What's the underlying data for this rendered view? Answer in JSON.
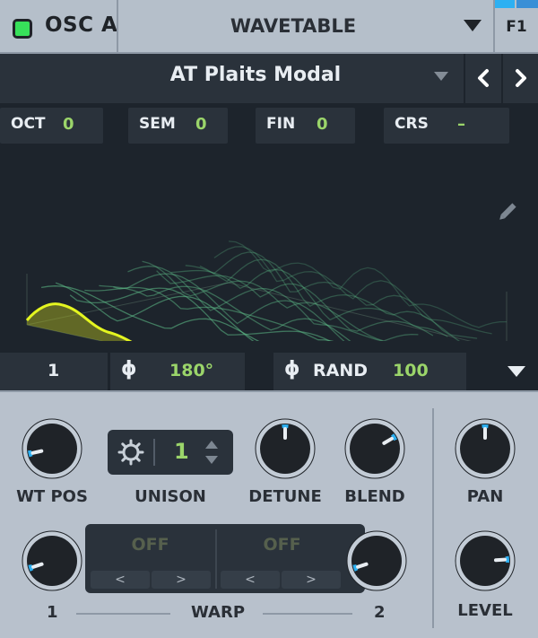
{
  "header": {
    "osc_name": "OSC A",
    "osc_enabled": true,
    "osc_type": "WAVETABLE",
    "route_label": "F1"
  },
  "wavetable": {
    "name": "AT Plaits Modal",
    "prev_icon": "chevron-left-icon",
    "next_icon": "chevron-right-icon"
  },
  "tuning": [
    {
      "label": "OCT",
      "value": "0"
    },
    {
      "label": "SEM",
      "value": "0"
    },
    {
      "label": "FIN",
      "value": "0"
    },
    {
      "label": "CRS",
      "value": "–"
    }
  ],
  "bottom_row": {
    "frame": "1",
    "phase_value": "180°",
    "rand_label": "RAND",
    "rand_value": "100"
  },
  "knobs": {
    "wt_pos": {
      "label": "WT POS",
      "value": 0.12
    },
    "detune": {
      "label": "DETUNE",
      "value": 0.5
    },
    "blend": {
      "label": "BLEND",
      "value": 0.72
    },
    "pan": {
      "label": "PAN",
      "value": 0.5
    },
    "warp1": {
      "value": 0.1
    },
    "warp2": {
      "value": 0.1
    },
    "level": {
      "label": "LEVEL",
      "value": 0.82
    }
  },
  "unison": {
    "label": "UNISON",
    "value": "1"
  },
  "warp": {
    "label": "WARP",
    "left_index": "1",
    "right_index": "2",
    "slot1": {
      "mode": "OFF",
      "prev": "<",
      "next": ">"
    },
    "slot2": {
      "mode": "OFF",
      "prev": "<",
      "next": ">"
    }
  },
  "colors": {
    "accent_green": "#9bd56a",
    "wave_yellow": "#e4f520",
    "knob_ring": "#2db0f2",
    "led_green": "#37e05a"
  }
}
